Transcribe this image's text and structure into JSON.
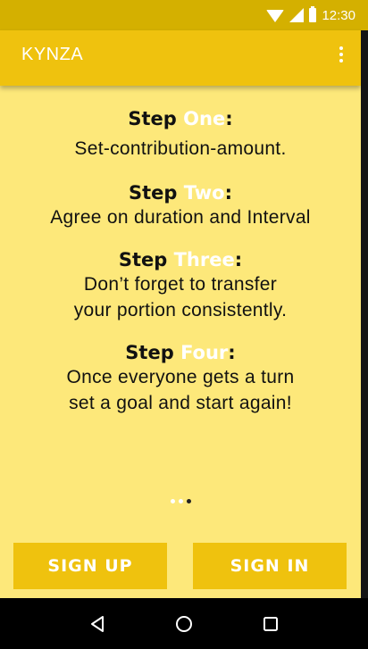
{
  "status_bar": {
    "time": "12:30",
    "icons": [
      "wifi-icon",
      "signal-icon",
      "battery-icon"
    ]
  },
  "app_bar": {
    "title": "KYNZA",
    "menu_icon": "overflow-menu-icon"
  },
  "steps": [
    {
      "word": "Step",
      "number": "One",
      "colon": ":",
      "lines": [
        "Set-contribution-amount."
      ]
    },
    {
      "word": "Step",
      "number": "Two",
      "colon": ":",
      "lines": [
        "Agree on duration and Interval"
      ]
    },
    {
      "word": "Step",
      "number": "Three",
      "colon": ":",
      "lines": [
        "Don’t forget to transfer",
        "your portion consistently."
      ]
    },
    {
      "word": "Step",
      "number": "Four",
      "colon": ":",
      "lines": [
        "Once everyone gets a turn",
        "set a goal and start again!"
      ]
    }
  ],
  "pager": {
    "total": 3,
    "active_index": 2
  },
  "buttons": {
    "sign_up": "SIGN UP",
    "sign_in": "SIGN IN"
  },
  "nav_bar": {
    "icons": [
      "back-icon",
      "home-icon",
      "recents-icon"
    ]
  },
  "colors": {
    "background": "#fde87a",
    "primary": "#efc20e",
    "status_bar": "#d4b000",
    "highlight_text": "#ffffff",
    "body_text": "#111111"
  }
}
